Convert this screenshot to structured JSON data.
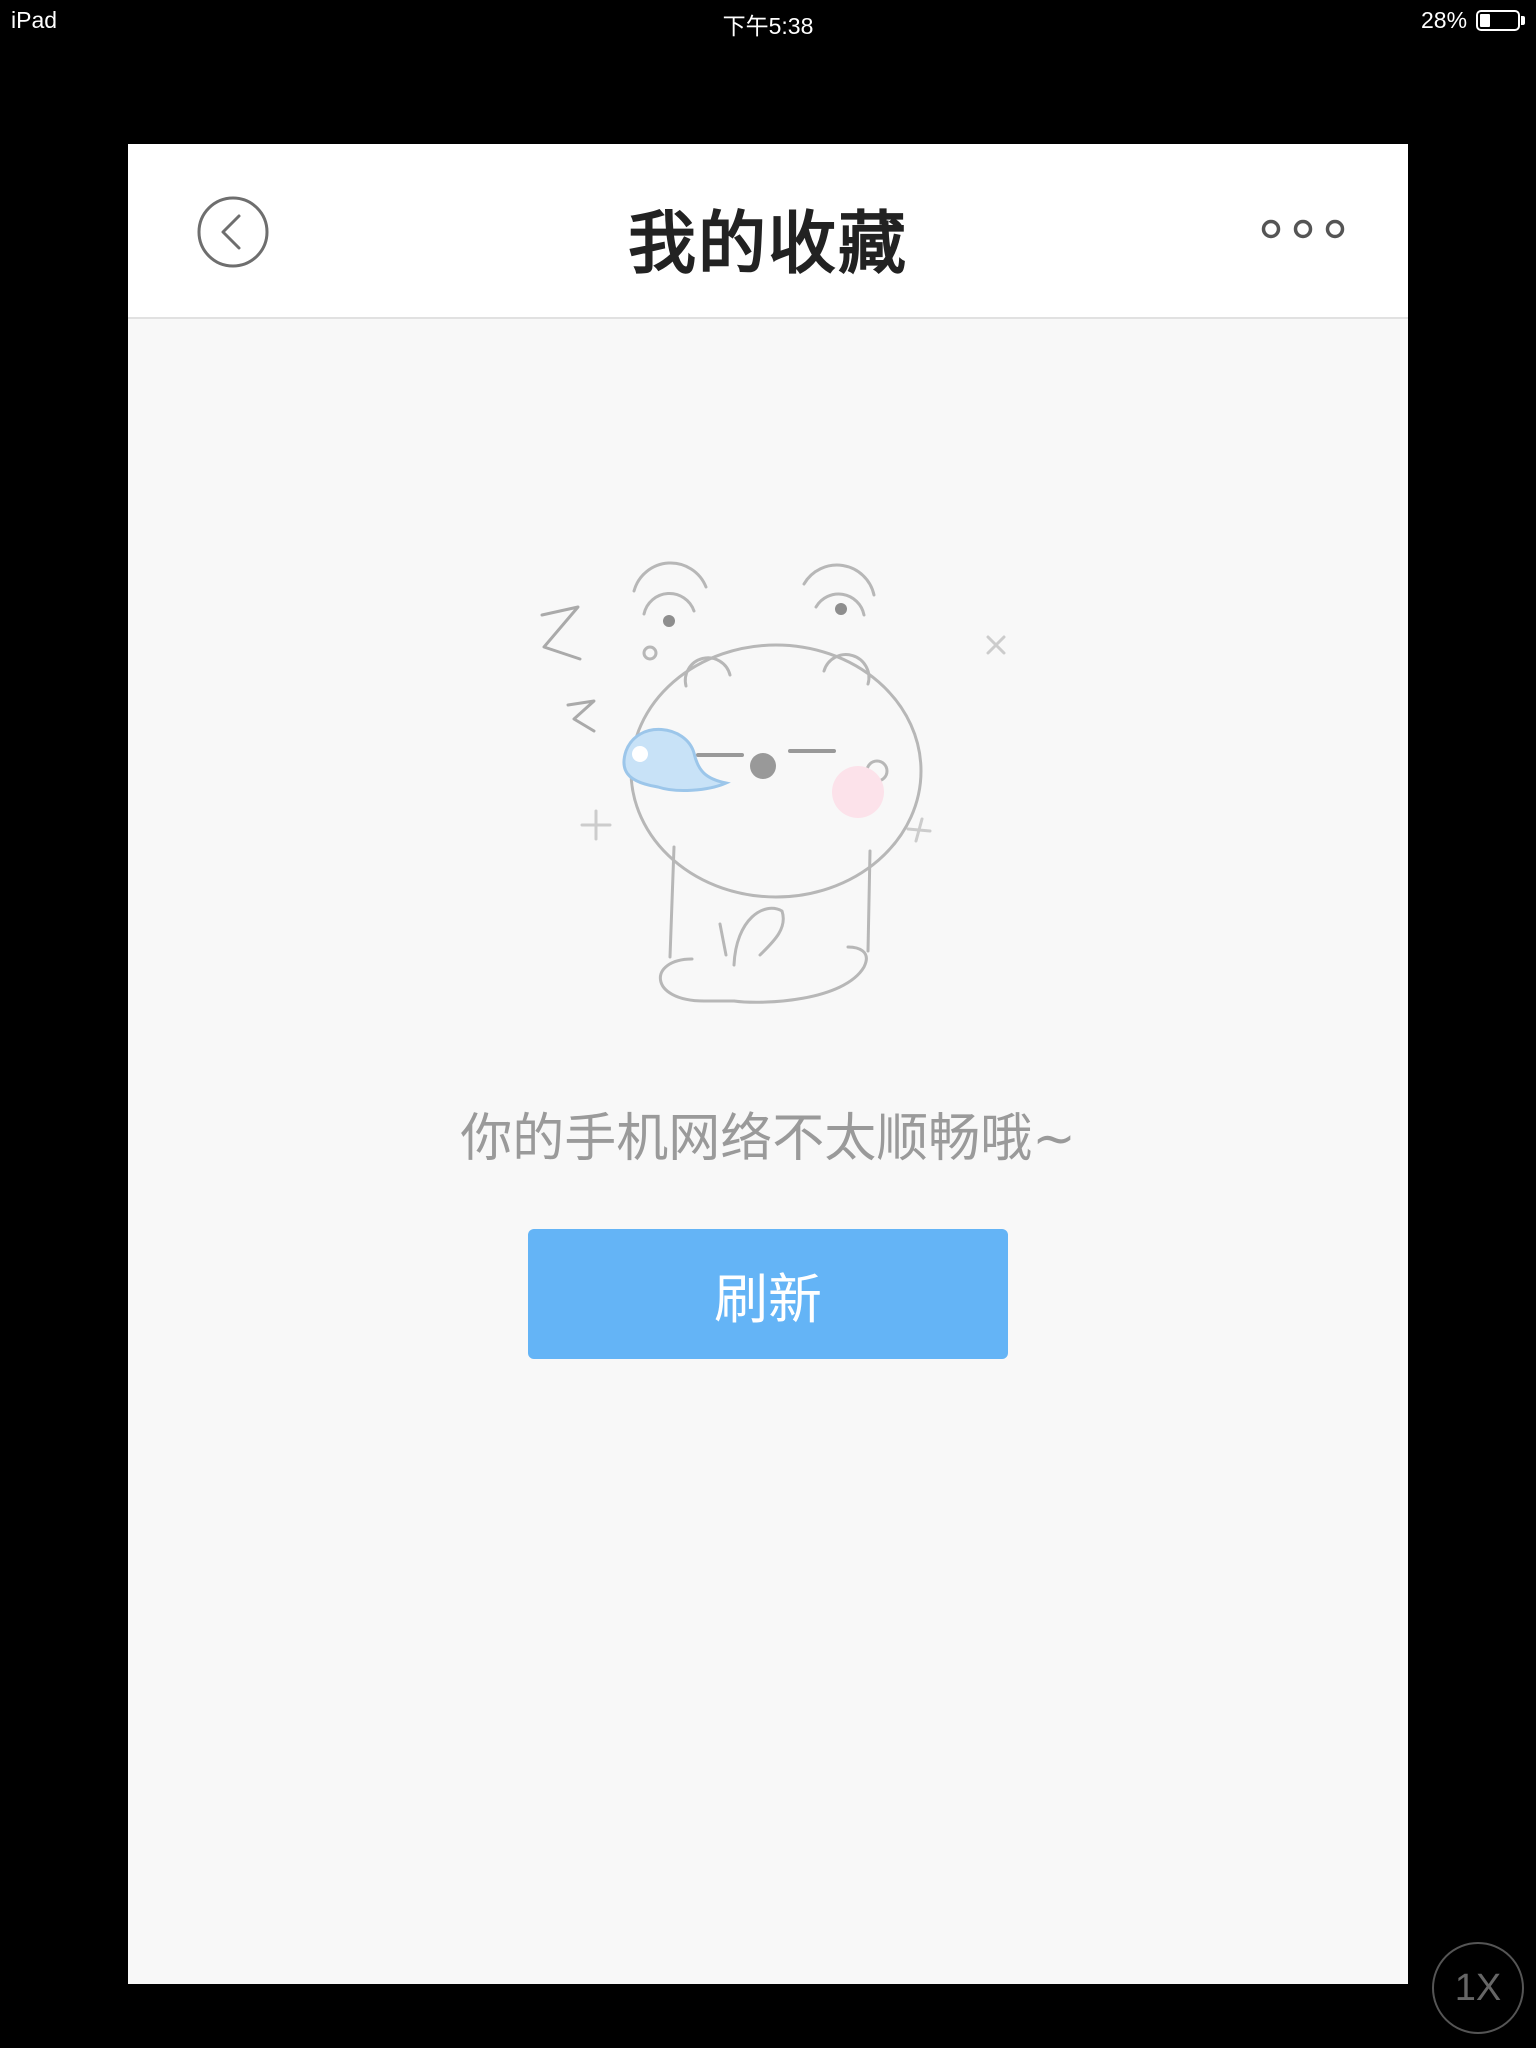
{
  "status_bar": {
    "device": "iPad",
    "time": "下午5:38",
    "battery_percent": "28%",
    "battery_level": 0.28
  },
  "nav": {
    "title": "我的收藏",
    "back_icon": "chevron-left-circle-icon",
    "more_icon": "more-dots-icon"
  },
  "empty_state": {
    "illustration_icon": "sleeping-bear-icon",
    "message": "你的手机网络不太顺畅哦~",
    "refresh_label": "刷新"
  },
  "zoom": {
    "label": "1X"
  },
  "colors": {
    "accent": "#64b4f6",
    "page_background": "#f8f8f8",
    "title_text": "#222222",
    "message_text": "#9a9a9a"
  }
}
